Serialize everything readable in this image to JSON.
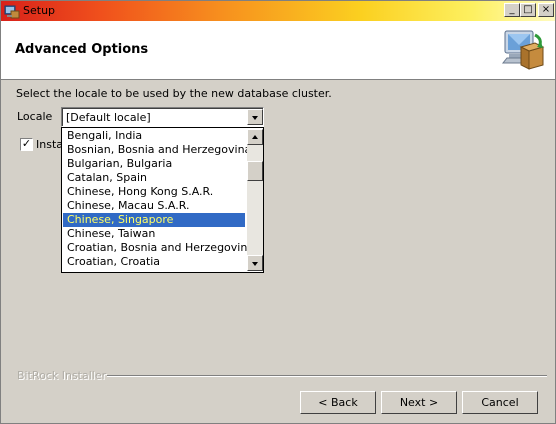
{
  "window": {
    "title": "Setup",
    "controls": {
      "minimize": "_",
      "maximize": "□",
      "close": "×"
    }
  },
  "header": {
    "title": "Advanced Options"
  },
  "main": {
    "instruction": "Select the locale to be used by the new database cluster.",
    "locale_label": "Locale",
    "locale_value": "[Default locale]",
    "checkbox_label": "Insta",
    "checkbox_checked": true,
    "dropdown_options": [
      "Bengali, India",
      "Bosnian, Bosnia and Herzegovina",
      "Bulgarian, Bulgaria",
      "Catalan, Spain",
      "Chinese, Hong Kong S.A.R.",
      "Chinese, Macau S.A.R.",
      "Chinese, Singapore",
      "Chinese, Taiwan",
      "Croatian, Bosnia and Herzegovina",
      "Croatian, Croatia"
    ],
    "selected_option": "Chinese, Singapore"
  },
  "footer": {
    "brand": "BitRock Installer",
    "back_label": "< Back",
    "next_label": "Next >",
    "cancel_label": "Cancel"
  },
  "colors": {
    "selection": "#316ac5",
    "selection_text": "#ffff66",
    "dialog": "#d4d0c8"
  }
}
